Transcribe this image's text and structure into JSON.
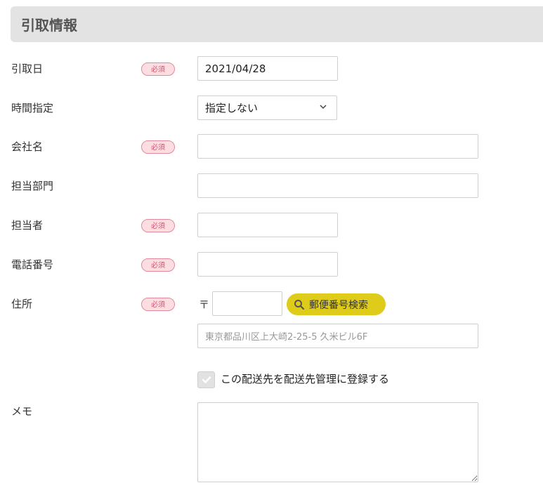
{
  "section": {
    "title": "引取情報"
  },
  "fields": {
    "pickup_date": {
      "label": "引取日",
      "required_badge": "必須",
      "value": "2021/04/28"
    },
    "time": {
      "label": "時間指定",
      "selected": "指定しない"
    },
    "company": {
      "label": "会社名",
      "required_badge": "必須",
      "value": ""
    },
    "department": {
      "label": "担当部門",
      "value": ""
    },
    "person": {
      "label": "担当者",
      "required_badge": "必須",
      "value": ""
    },
    "phone": {
      "label": "電話番号",
      "required_badge": "必須",
      "value": ""
    },
    "address": {
      "label": "住所",
      "required_badge": "必須",
      "zip_mark": "〒",
      "zip_value": "",
      "zip_search_label": "郵便番号検索",
      "placeholder": "東京都品川区上大崎2-25-5 久米ビル6F"
    },
    "register": {
      "label": "この配送先を配送先管理に登録する",
      "checked": true
    },
    "memo": {
      "label": "メモ",
      "value": ""
    }
  },
  "colors": {
    "header_bg": "#e3e3e3",
    "required_bg": "#fbdde2",
    "required_text": "#d0586e",
    "zip_button": "#dfcc1a"
  },
  "icons": [
    "chevron-down-icon",
    "search-icon",
    "checkmark-icon"
  ]
}
